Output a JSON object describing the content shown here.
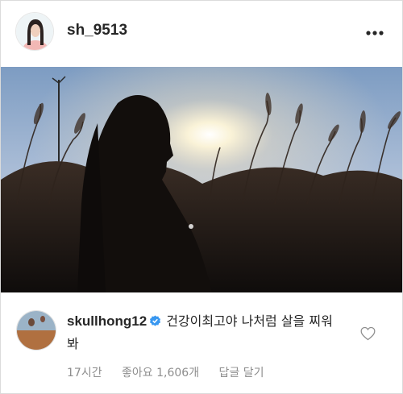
{
  "post": {
    "username": "sh_9513",
    "menu_icon": "more-horizontal-icon"
  },
  "comment": {
    "username": "skullhong12",
    "verified_icon": "verified-badge-icon",
    "text": "건강이최고야 나처럼 살을 찌워봐",
    "time": "17시간",
    "likes": "좋아요 1,606개",
    "reply_label": "답글 달기",
    "like_icon": "heart-outline-icon"
  },
  "colors": {
    "verified": "#3897f0",
    "muted": "#8e8e8e",
    "text": "#262626"
  }
}
